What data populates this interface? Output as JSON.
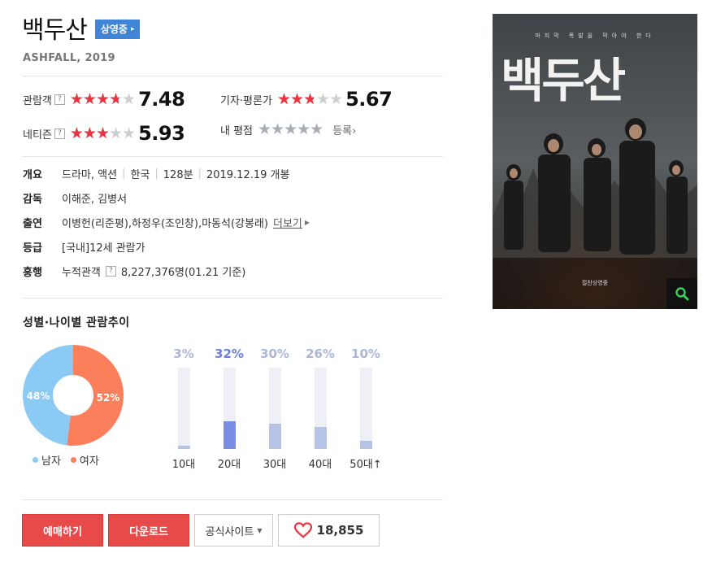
{
  "movie": {
    "title": "백두산",
    "status_badge": "상영중",
    "subtitle": "ASHFALL, 2019"
  },
  "ratings": {
    "audience": {
      "label": "관람객",
      "score": "7.48",
      "value": 7.48
    },
    "critics": {
      "label": "기자·평론가",
      "score": "5.67",
      "value": 5.67
    },
    "netizen": {
      "label": "네티즌",
      "score": "5.93",
      "value": 5.93
    },
    "my": {
      "label": "내 평점",
      "register_label": "등록"
    }
  },
  "info": {
    "overview_label": "개요",
    "genre": "드라마, 액션",
    "country": "한국",
    "runtime": "128분",
    "release": "2019.12.19 개봉",
    "director_label": "감독",
    "directors": "이해준, 김병서",
    "cast_label": "출연",
    "cast_1_name": "이병헌",
    "cast_1_role": "(리준평), ",
    "cast_2_name": "하정우",
    "cast_2_role": "(조인창), ",
    "cast_3_name": "마동석",
    "cast_3_role": "(강봉래)",
    "cast_more": "더보기",
    "grade_label": "등급",
    "grade_prefix": "[국내] ",
    "grade": "12세 관람가",
    "boxoffice_label": "흥행",
    "boxoffice_prefix": "누적관객",
    "boxoffice": "8,227,376명(01.21 기준)"
  },
  "trend": {
    "title": "성별·나이별 관람추이",
    "gender": {
      "male_pct": "48%",
      "female_pct": "52%",
      "male_label": "남자",
      "female_label": "여자",
      "male_value": 48,
      "female_value": 52,
      "male_color": "#8ccaf6",
      "female_color": "#fb7f5a"
    },
    "ages": [
      {
        "label": "10대",
        "pct": "3%",
        "value": 3
      },
      {
        "label": "20대",
        "pct": "32%",
        "value": 32
      },
      {
        "label": "30대",
        "pct": "30%",
        "value": 30
      },
      {
        "label": "40대",
        "pct": "26%",
        "value": 26
      },
      {
        "label": "50대↑",
        "pct": "10%",
        "value": 10
      }
    ]
  },
  "buttons": {
    "reserve": "예매하기",
    "download": "다운로드",
    "official": "공식사이트",
    "likes": "18,855"
  },
  "poster": {
    "tagline": "마지막 폭발을 막아야 한다",
    "title": "백두산",
    "release": "절찬상영중"
  },
  "colors": {
    "accent_red": "#e8353f",
    "link_blue": "#2e6bb5",
    "badge_blue": "#3f84d6"
  }
}
